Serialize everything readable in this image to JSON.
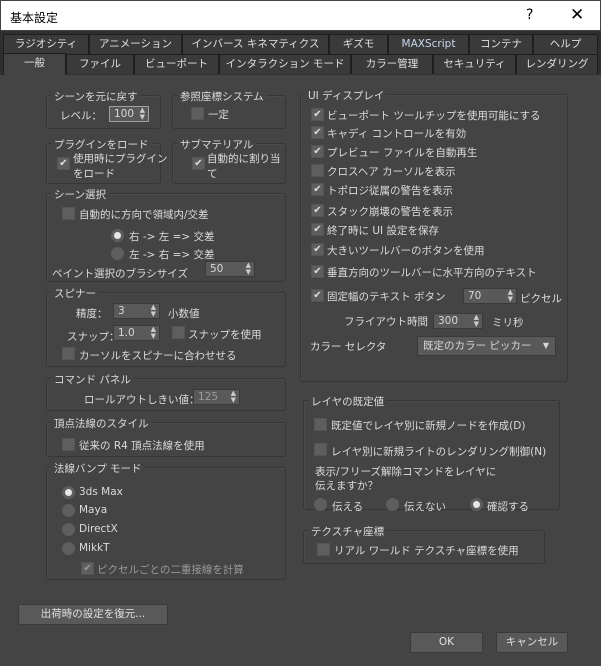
{
  "window": {
    "title": "基本設定",
    "help_label": "?",
    "close_label": "✕"
  },
  "tabs_row1": [
    "ラジオシティ",
    "アニメーション",
    "インバース キネマティクス",
    "ギズモ",
    "MAXScript",
    "コンテナ",
    "ヘルプ"
  ],
  "tabs_row2": [
    "一般",
    "ファイル",
    "ビューポート",
    "インタラクション モード",
    "カラー管理",
    "セキュリティ",
    "レンダリング"
  ],
  "active_tab": "一般",
  "scene_undo": {
    "title": "シーンを元に戻す",
    "level_label": "レベル：",
    "level_value": "100"
  },
  "ref_coord": {
    "title": "参照座標システム",
    "constant_label": "一定",
    "constant_checked": false
  },
  "plugin_load": {
    "title": "プラグインをロード",
    "line1": "使用時にプラグイン",
    "line2": "をロード",
    "checked": true
  },
  "submaterial": {
    "title": "サブマテリアル",
    "line1": "自動的に割り当",
    "line2": "て",
    "checked": true
  },
  "scene_select": {
    "title": "シーン選択",
    "auto_label": "自動的に方向で領域内/交差",
    "auto_checked": false,
    "radio1": "右 -> 左 => 交差",
    "radio2": "左 -> 右 => 交差",
    "selected_radio": 1,
    "brush_label": "ペイント選択のブラシサイズ",
    "brush_value": "50"
  },
  "spinner": {
    "title": "スピナー",
    "precision_label": "精度：",
    "precision_value": "3",
    "decimal_label": "小数値",
    "snap_label": "スナップ：",
    "snap_value": "1.0",
    "use_snap_label": "スナップを使用",
    "use_snap_checked": false,
    "wrap_cursor_label": "カーソルをスピナーに合わせせる",
    "wrap_cursor_checked": false
  },
  "command_panel": {
    "title": "コマンド パネル",
    "rollout_label": "ロールアウトしきい値：",
    "rollout_value": "125"
  },
  "vertex_normal": {
    "title": "頂点法線のスタイル",
    "legacy_label": "従来の R4 頂点法線を使用",
    "checked": false
  },
  "normal_bump": {
    "title": "法線バンプ モード",
    "options": [
      "3ds Max",
      "Maya",
      "DirectX",
      "MikkT"
    ],
    "selected": "3ds Max",
    "per_pixel_label": "ピクセルごとの二重接線を計算",
    "per_pixel_checked": true
  },
  "restore_button": "出荷時の設定を復元...",
  "ui_display": {
    "title": "UI ディスプレイ",
    "items": [
      {
        "label": "ビューポート ツールチップを使用可能にする",
        "checked": true
      },
      {
        "label": "キャディ コントロールを有効",
        "checked": true
      },
      {
        "label": "プレビュー ファイルを自動再生",
        "checked": true
      },
      {
        "label": "クロスヘア カーソルを表示",
        "checked": false
      },
      {
        "label": "トポロジ従属の警告を表示",
        "checked": true
      },
      {
        "label": "スタック崩壊の警告を表示",
        "checked": true
      },
      {
        "label": "終了時に UI 設定を保存",
        "checked": true
      },
      {
        "label": "大きいツールバーのボタンを使用",
        "checked": true
      },
      {
        "label": "垂直方向のツールバーに水平方向のテキスト",
        "checked": true
      },
      {
        "label": "固定幅のテキスト ボタン",
        "checked": true
      }
    ],
    "fixed_width_value": "70",
    "pixel_unit": "ピクセル",
    "flyout_label": "フライアウト時間",
    "flyout_value": "300",
    "ms_unit": "ミリ秒",
    "color_selector_label": "カラー セレクタ",
    "color_selector_value": "既定のカラー ピッカー"
  },
  "layer_defaults": {
    "title": "レイヤの既定値",
    "new_node_label": "既定値でレイヤ別に新規ノードを作成(D)",
    "new_light_label": "レイヤ別に新規ライトのレンダリング制御(N)",
    "question_line1": "表示/フリーズ解除コマンドをレイヤに",
    "question_line2": "伝えますか？",
    "options": [
      "伝える",
      "伝えない",
      "確認する"
    ],
    "selected": "確認する"
  },
  "texture_coords": {
    "title": "テクスチャ座標",
    "real_world_label": "リアル ワールド テクスチャ座標を使用",
    "checked": false
  },
  "ok_button": "OK",
  "cancel_button": "キャンセル"
}
